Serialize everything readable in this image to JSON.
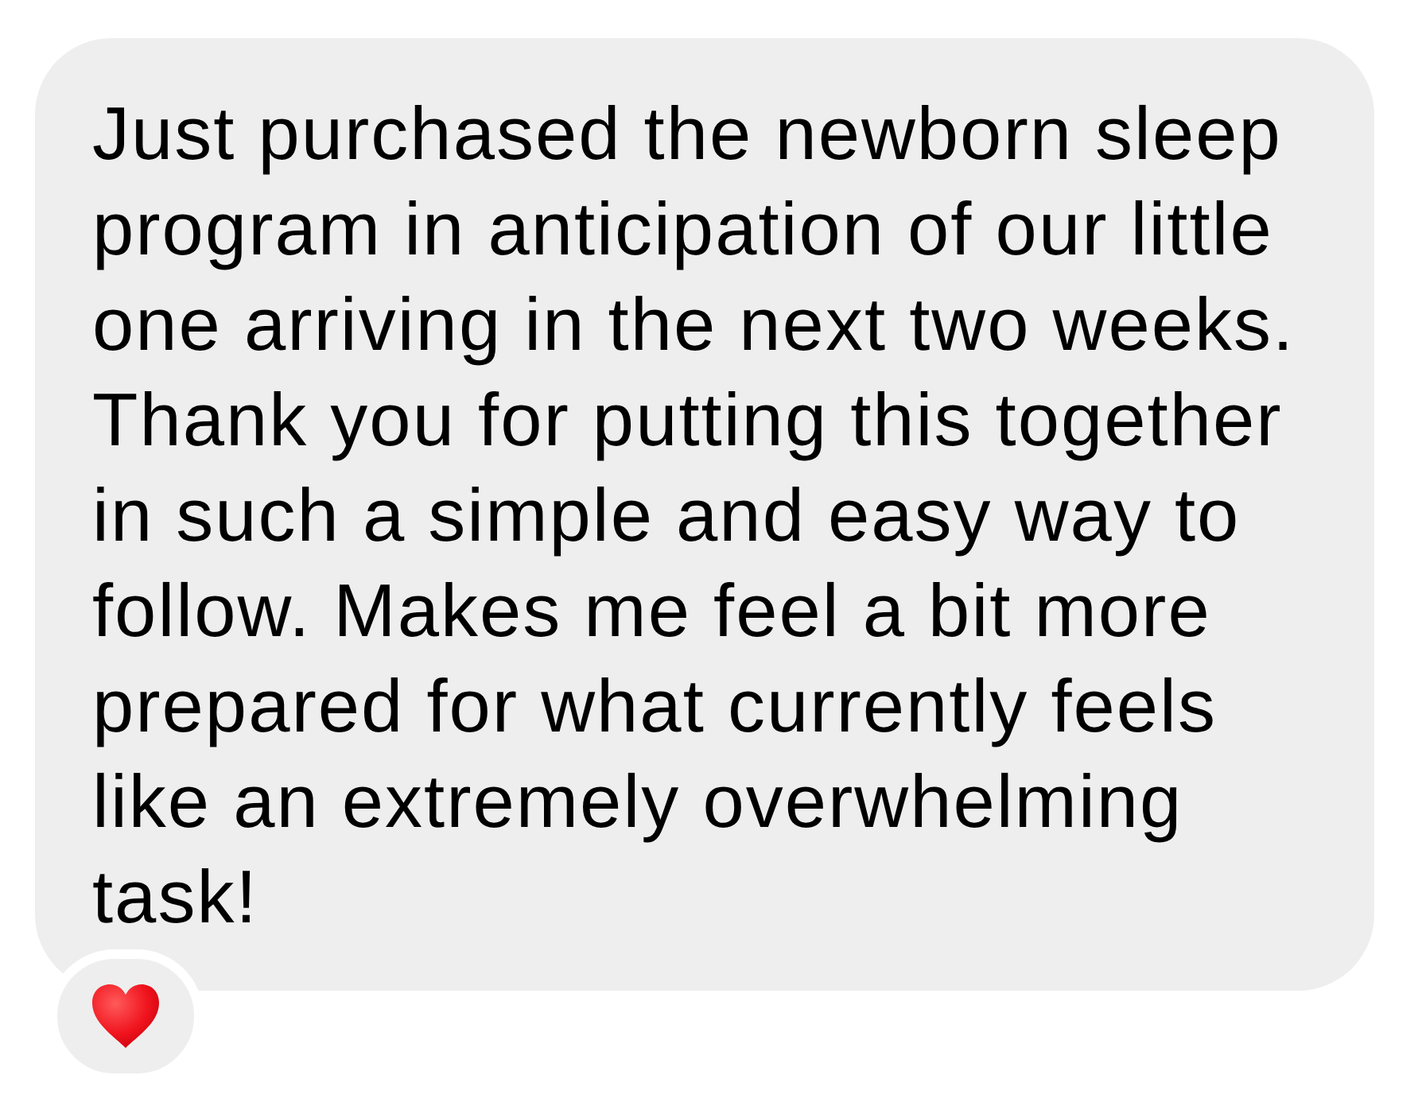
{
  "message": {
    "text": "Just purchased the newborn sleep program in anticipation of our little one arriving in the next two weeks. Thank you for putting this together in such a simple and easy way to follow. Makes me feel a bit more prepared for what currently feels like an extremely overwhelming task!",
    "reacted": true
  }
}
